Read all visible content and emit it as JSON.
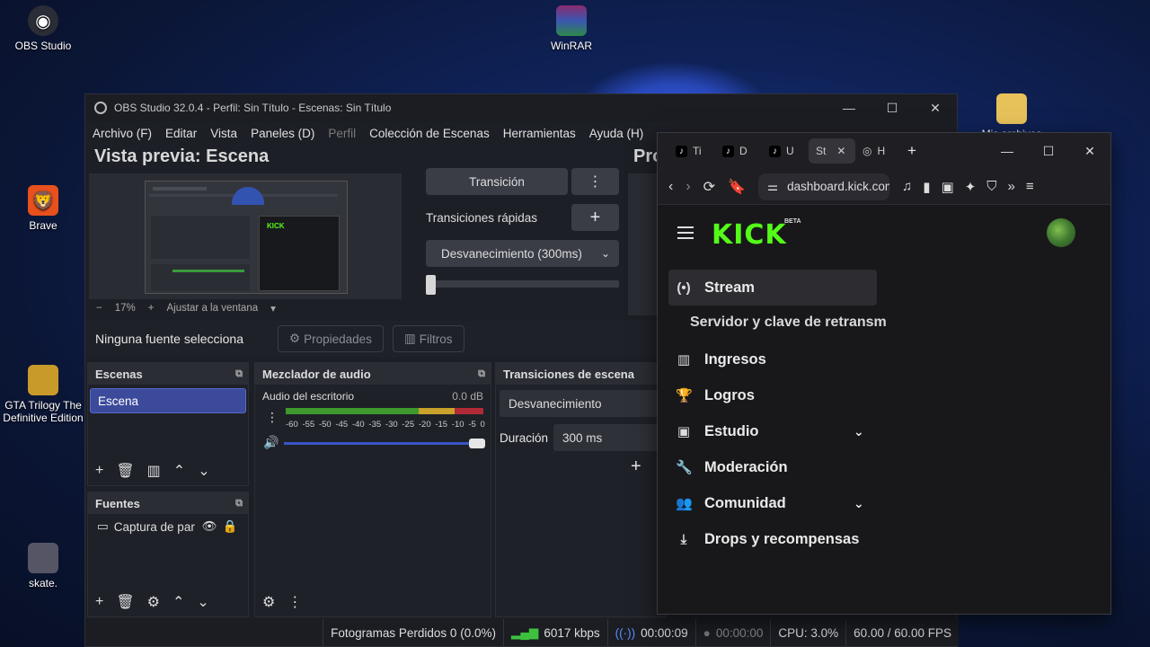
{
  "desktop": {
    "icons": [
      "OBS Studio",
      "WinRAR",
      "Brave",
      "GTA Trilogy The Definitive Edition",
      "skate.",
      "Mis archivos"
    ]
  },
  "obs": {
    "title": "OBS Studio 32.0.4 - Perfil: Sin Título - Escenas: Sin Título",
    "menu": [
      "Archivo (F)",
      "Editar",
      "Vista",
      "Paneles (D)",
      "Perfil",
      "Colección de Escenas",
      "Herramientas",
      "Ayuda (H)"
    ],
    "preview_title": "Vista previa: Escena",
    "program_title": "Pro",
    "zoom": {
      "minus": "−",
      "level": "17%",
      "plus": "+",
      "fit": "Ajustar a la ventana"
    },
    "transition_button": "Transición",
    "quick_transitions": "Transiciones rápidas",
    "fade_select": "Desvanecimiento (300ms)",
    "source_status": "Ninguna fuente selecciona",
    "properties": "Propiedades",
    "filters": "Filtros",
    "scenes": {
      "title": "Escenas",
      "items": [
        "Escena"
      ]
    },
    "sources": {
      "title": "Fuentes",
      "items": [
        "Captura de par"
      ]
    },
    "mixer": {
      "title": "Mezclador de audio",
      "channel": "Audio del escritorio",
      "db": "0.0 dB",
      "ticks": [
        "-60",
        "-55",
        "-50",
        "-45",
        "-40",
        "-35",
        "-30",
        "-25",
        "-20",
        "-15",
        "-10",
        "-5",
        "0"
      ]
    },
    "scene_transitions": {
      "title": "Transiciones de escena",
      "type": "Desvanecimiento",
      "duration_label": "Duración",
      "duration": "300 ms"
    },
    "status": {
      "dropped": "Fotogramas Perdidos 0 (0.0%)",
      "bitrate": "6017 kbps",
      "stream_time": "00:00:09",
      "rec_time": "00:00:00",
      "cpu": "CPU: 3.0%",
      "fps": "60.00 / 60.00 FPS"
    }
  },
  "browser": {
    "tabs": [
      "Ti",
      "D",
      "U",
      "St",
      "H"
    ],
    "url": "dashboard.kick.com",
    "logo": "KICK",
    "beta": "BETA",
    "menu": {
      "stream": "Stream",
      "stream_sub": "Servidor y clave de retransm",
      "ingresos": "Ingresos",
      "logros": "Logros",
      "estudio": "Estudio",
      "moderacion": "Moderación",
      "comunidad": "Comunidad",
      "drops": "Drops y recompensas"
    },
    "accent": "#53fc18"
  }
}
